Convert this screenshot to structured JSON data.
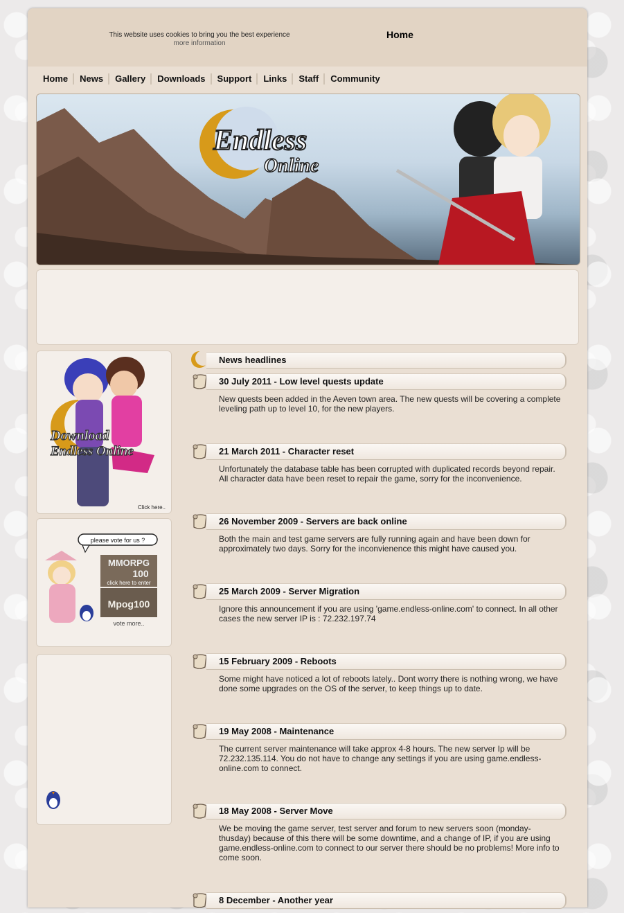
{
  "cookie": {
    "text": "This website uses cookies to bring you the best experience",
    "more": "more information"
  },
  "page_title": "Home",
  "nav": [
    "Home",
    "News",
    "Gallery",
    "Downloads",
    "Support",
    "Links",
    "Staff",
    "Community"
  ],
  "banner": {
    "logo_line1": "Endless",
    "logo_line2": "Online"
  },
  "sidebar": {
    "download": {
      "line1": "Download",
      "line2": "Endless Online",
      "click": "Click here.."
    },
    "vote": {
      "bubble": "please vote for us ?",
      "mmorpg_top": "MMORPG",
      "mmorpg_num": "100",
      "mmorpg_click": "click here to enter",
      "mpog": "Mpog100",
      "more": "vote more.."
    }
  },
  "news": {
    "heading": "News headlines",
    "items": [
      {
        "title": "30 July 2011 - Low level quests update",
        "body": "New quests been added in the Aeven town area. The new quests will be covering a complete leveling path up to level 10, for the new players."
      },
      {
        "title": "21 March 2011 - Character reset",
        "body": "Unfortunately the database table has been corrupted with duplicated records beyond repair. All character data have been reset to repair the game, sorry for the inconvenience."
      },
      {
        "title": "26 November 2009 - Servers are back online",
        "body": "Both the main and test game servers are fully running again and have been down for approximately two days. Sorry for the inconvienence this might have caused you."
      },
      {
        "title": "25 March 2009 - Server Migration",
        "body": "Ignore this announcement if you are using 'game.endless-online.com' to connect. In all other cases the new server IP is : 72.232.197.74"
      },
      {
        "title": "15 February 2009 - Reboots",
        "body": "Some might have noticed a lot of reboots lately.. Dont worry there is nothing wrong, we have done some upgrades on the OS of the server, to keep things up to date."
      },
      {
        "title": "19 May 2008 - Maintenance",
        "body": "The current server maintenance will take approx 4-8 hours. The new server Ip will be 72.232.135.114. You do not have to change any settings if you are using game.endless-online.com to connect."
      },
      {
        "title": "18 May 2008 - Server Move",
        "body": "We be moving the game server, test server and forum to new servers soon (monday-thusday) because of this there will be some downtime, and a change of IP, if you are using game.endless-online.com to connect to our server there should be no problems! More info to come soon."
      },
      {
        "title": "8 December - Another year",
        "body": ""
      }
    ]
  }
}
